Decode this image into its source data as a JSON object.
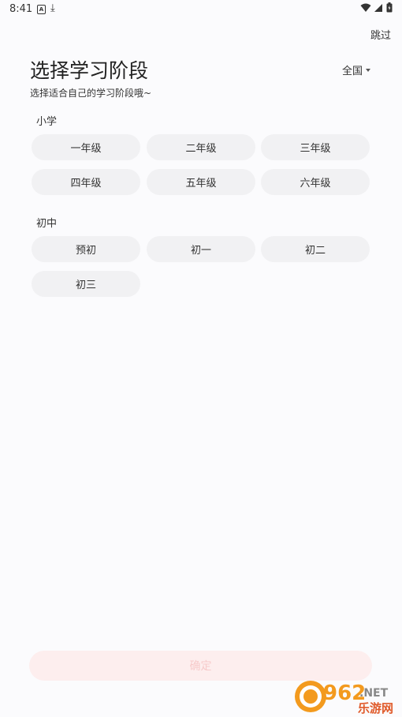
{
  "status_bar": {
    "time": "8:41",
    "icons": [
      "a-icon",
      "download-icon",
      "wifi-icon",
      "signal-icon",
      "battery-icon"
    ]
  },
  "header": {
    "skip_label": "跳过",
    "title": "选择学习阶段",
    "subtitle": "选择适合自己的学习阶段哦~",
    "region_label": "全国"
  },
  "sections": [
    {
      "label": "小学",
      "items": [
        "一年级",
        "二年级",
        "三年级",
        "四年级",
        "五年级",
        "六年级"
      ]
    },
    {
      "label": "初中",
      "items": [
        "预初",
        "初一",
        "初二",
        "初三"
      ]
    }
  ],
  "confirm_label": "确定",
  "watermark": {
    "number": "962",
    "suffix": ".NET",
    "cn": "乐游网"
  },
  "colors": {
    "chip_bg": "#f1f1f3",
    "confirm_bg": "#fdeeee",
    "confirm_text": "#f7caca",
    "watermark_orange": "#f39a1e"
  }
}
